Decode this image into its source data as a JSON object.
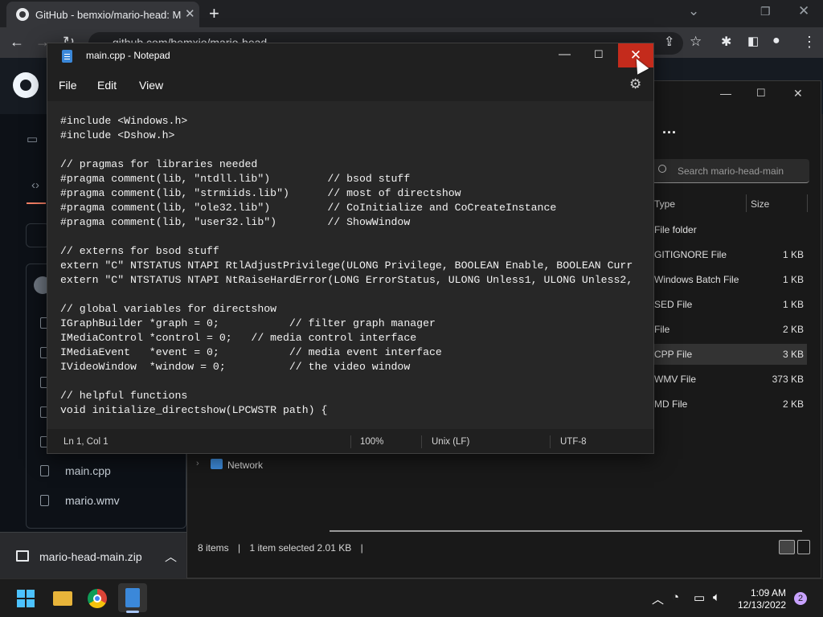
{
  "browser": {
    "tab_title": "GitHub - bemxio/mario-head: Made",
    "address": "github.com/bemxio/mario-head"
  },
  "github": {
    "files": [
      {
        "name": "main.cpp"
      },
      {
        "name": "mario.wmv"
      }
    ]
  },
  "download": {
    "file_name": "mario-head-main.zip"
  },
  "explorer": {
    "more_label": "...",
    "search_placeholder": "Search mario-head-main",
    "columns": {
      "type": "Type",
      "size": "Size"
    },
    "rows": [
      {
        "type": "File folder",
        "size": ""
      },
      {
        "type": "GITIGNORE File",
        "size": "1 KB"
      },
      {
        "type": "Windows Batch File",
        "size": "1 KB"
      },
      {
        "type": "SED File",
        "size": "1 KB"
      },
      {
        "type": "File",
        "size": "2 KB"
      },
      {
        "type": "CPP File",
        "size": "3 KB"
      },
      {
        "type": "WMV File",
        "size": "373 KB"
      },
      {
        "type": "MD File",
        "size": "2 KB"
      }
    ],
    "nav_network": "Network",
    "status": {
      "items": "8 items",
      "selected": "1 item selected  2.01 KB"
    }
  },
  "notepad": {
    "title": "main.cpp - Notepad",
    "menu": {
      "file": "File",
      "edit": "Edit",
      "view": "View"
    },
    "code": "#include <Windows.h>\n#include <Dshow.h>\n\n// pragmas for libraries needed\n#pragma comment(lib, \"ntdll.lib\")         // bsod stuff\n#pragma comment(lib, \"strmiids.lib\")      // most of directshow\n#pragma comment(lib, \"ole32.lib\")         // CoInitialize and CoCreateInstance\n#pragma comment(lib, \"user32.lib\")        // ShowWindow\n\n// externs for bsod stuff\nextern \"C\" NTSTATUS NTAPI RtlAdjustPrivilege(ULONG Privilege, BOOLEAN Enable, BOOLEAN Curr\nextern \"C\" NTSTATUS NTAPI NtRaiseHardError(LONG ErrorStatus, ULONG Unless1, ULONG Unless2,\n\n// global variables for directshow\nIGraphBuilder *graph = 0;           // filter graph manager\nIMediaControl *control = 0;   // media control interface\nIMediaEvent   *event = 0;           // media event interface\nIVideoWindow  *window = 0;          // the video window\n\n// helpful functions\nvoid initialize_directshow(LPCWSTR path) {",
    "status": {
      "position": "Ln 1, Col 1",
      "zoom": "100%",
      "line_ending": "Unix (LF)",
      "encoding": "UTF-8"
    }
  },
  "taskbar": {
    "time": "1:09 AM",
    "date": "12/13/2022",
    "notification_count": "2"
  },
  "icons": {
    "close": "close-icon",
    "settings": "gear-icon",
    "search": "search-icon"
  },
  "colors": {
    "close_hover": "#c42b1c",
    "accent": "#3b88d9"
  }
}
